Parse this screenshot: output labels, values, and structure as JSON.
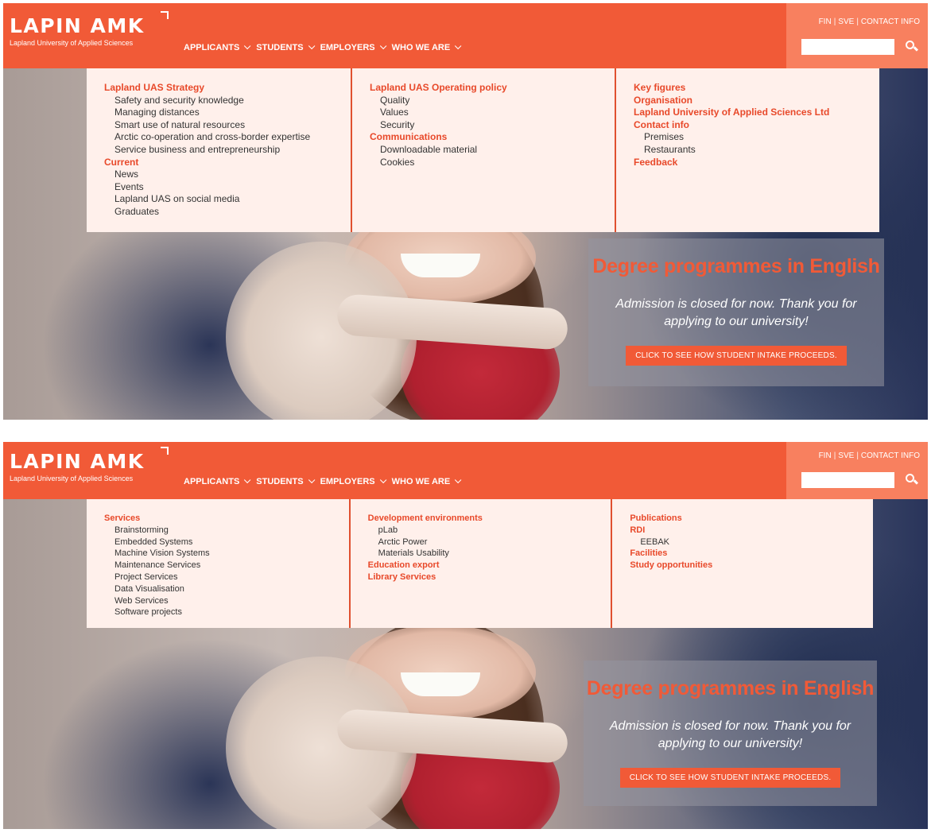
{
  "colors": {
    "brand": "#f15a37",
    "utility": "#f8805f",
    "menu_bg": "#fff0eb",
    "menu_heading": "#e8492a"
  },
  "header": {
    "logo": "LAPIN AMK",
    "logo_sub": "Lapland University of Applied Sciences",
    "nav": [
      "APPLICANTS",
      "STUDENTS",
      "EMPLOYERS",
      "WHO WE ARE"
    ],
    "util_links": [
      "FIN",
      "SVE",
      "CONTACT INFO"
    ],
    "search_value": ""
  },
  "promo": {
    "title": "Degree programmes in English",
    "text": "Admission is closed for now. Thank you for applying to our university!",
    "button": "CLICK TO SEE HOW STUDENT INTAKE PROCEEDS."
  },
  "menu1": {
    "col1": [
      {
        "label": "Lapland UAS Strategy",
        "type": "head"
      },
      {
        "label": "Safety and security knowledge",
        "type": "sub"
      },
      {
        "label": "Managing distances",
        "type": "sub"
      },
      {
        "label": "Smart use of natural resources",
        "type": "sub"
      },
      {
        "label": "Arctic co-operation and cross-border expertise",
        "type": "sub"
      },
      {
        "label": "Service business and entrepreneurship",
        "type": "sub"
      },
      {
        "label": "Current",
        "type": "head"
      },
      {
        "label": "News",
        "type": "sub"
      },
      {
        "label": "Events",
        "type": "sub"
      },
      {
        "label": "Lapland UAS on social media",
        "type": "sub"
      },
      {
        "label": "Graduates",
        "type": "sub"
      }
    ],
    "col2": [
      {
        "label": "Lapland UAS Operating policy",
        "type": "head"
      },
      {
        "label": "Quality",
        "type": "sub"
      },
      {
        "label": "Values",
        "type": "sub"
      },
      {
        "label": "Security",
        "type": "sub"
      },
      {
        "label": "Communications",
        "type": "head"
      },
      {
        "label": "Downloadable material",
        "type": "sub"
      },
      {
        "label": "Cookies",
        "type": "sub"
      }
    ],
    "col3": [
      {
        "label": "Key figures",
        "type": "head"
      },
      {
        "label": "Organisation",
        "type": "head"
      },
      {
        "label": "Lapland University of Applied Sciences Ltd",
        "type": "head"
      },
      {
        "label": "Contact info",
        "type": "head"
      },
      {
        "label": "Premises",
        "type": "sub"
      },
      {
        "label": "Restaurants",
        "type": "sub"
      },
      {
        "label": "Feedback",
        "type": "head"
      }
    ]
  },
  "menu2": {
    "col1": [
      {
        "label": "Services",
        "type": "head"
      },
      {
        "label": "Brainstorming",
        "type": "sub"
      },
      {
        "label": "Embedded Systems",
        "type": "sub"
      },
      {
        "label": "Machine Vision Systems",
        "type": "sub"
      },
      {
        "label": "Maintenance Services",
        "type": "sub"
      },
      {
        "label": "Project Services",
        "type": "sub"
      },
      {
        "label": "Data Visualisation",
        "type": "sub"
      },
      {
        "label": "Web Services",
        "type": "sub"
      },
      {
        "label": "Software projects",
        "type": "sub"
      }
    ],
    "col2": [
      {
        "label": "Development environments",
        "type": "head"
      },
      {
        "label": "pLab",
        "type": "sub"
      },
      {
        "label": "Arctic Power",
        "type": "sub"
      },
      {
        "label": "Materials Usability",
        "type": "sub"
      },
      {
        "label": "Education export",
        "type": "head"
      },
      {
        "label": "Library Services",
        "type": "head"
      }
    ],
    "col3": [
      {
        "label": "Publications",
        "type": "head"
      },
      {
        "label": "RDI",
        "type": "head"
      },
      {
        "label": "EEBAK",
        "type": "sub"
      },
      {
        "label": "Facilities",
        "type": "head"
      },
      {
        "label": "Study opportunities",
        "type": "head"
      }
    ]
  }
}
